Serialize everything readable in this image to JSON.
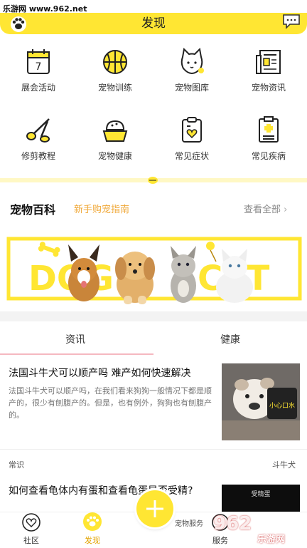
{
  "watermark": "乐游网 www.962.net",
  "header": {
    "title": "发现"
  },
  "grid": [
    {
      "label": "展会活动",
      "icon": "calendar-icon"
    },
    {
      "label": "宠物训练",
      "icon": "ball-icon"
    },
    {
      "label": "宠物图库",
      "icon": "cat-icon"
    },
    {
      "label": "宠物资讯",
      "icon": "newspaper-icon"
    },
    {
      "label": "修剪教程",
      "icon": "scissors-icon"
    },
    {
      "label": "宠物健康",
      "icon": "bowl-icon"
    },
    {
      "label": "常见症状",
      "icon": "clipboard-heart-icon"
    },
    {
      "label": "常见疾病",
      "icon": "medical-report-icon"
    }
  ],
  "baike": {
    "title": "宠物百科",
    "subtitle": "新手购宠指南",
    "view_all": "查看全部"
  },
  "banner": {
    "left": "DOG",
    "right": "CAT"
  },
  "tabs": [
    {
      "label": "资讯"
    },
    {
      "label": "健康"
    }
  ],
  "articles": [
    {
      "title": "法国斗牛犬可以顺产吗 难产如何快速解决",
      "body": "法国斗牛犬可以顺产吗，在我们看来狗狗一般情况下都是顺产的，很少有刨腹产的。但是，也有例外，狗狗也有刨腹产的。",
      "tag_left": "常识",
      "tag_right": "斗牛犬",
      "image_caption": "小心口水"
    },
    {
      "title": "如何查看龟体内有蛋和查看龟蛋是否受精?",
      "image_caption": "受精蛋"
    }
  ],
  "bottom_nav": [
    {
      "label": "社区",
      "icon": "heart-chat-icon"
    },
    {
      "label": "发现",
      "icon": "paw-icon"
    },
    {
      "label": "服务",
      "icon": "service-icon"
    }
  ],
  "bottom_partial_text": "宠物服务",
  "watermark2": "962",
  "watermark3": "乐游网",
  "colors": {
    "accent": "#ffe633",
    "orange": "#f0a93a"
  }
}
